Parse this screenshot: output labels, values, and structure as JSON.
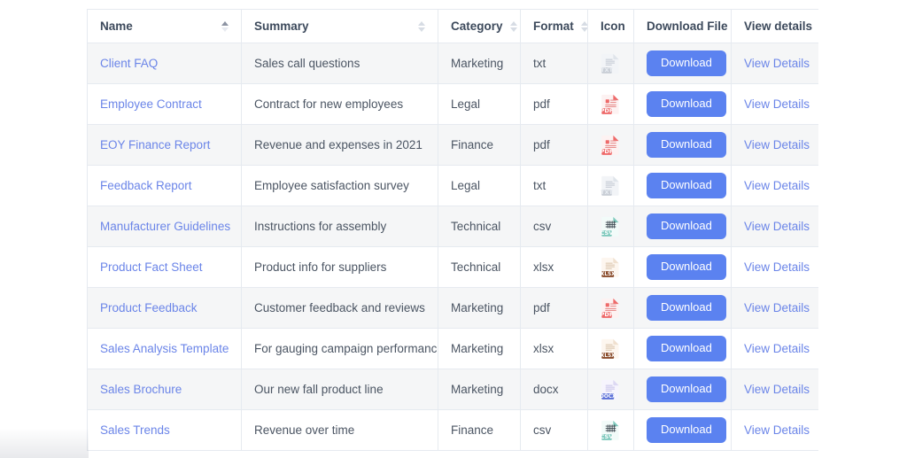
{
  "table": {
    "columns": [
      {
        "key": "name",
        "label": "Name",
        "sort": "asc",
        "sortable": true
      },
      {
        "key": "summary",
        "label": "Summary",
        "sort": "none",
        "sortable": true
      },
      {
        "key": "category",
        "label": "Category",
        "sort": "none",
        "sortable": true
      },
      {
        "key": "format",
        "label": "Format",
        "sort": "none",
        "sortable": true
      },
      {
        "key": "icon",
        "label": "Icon",
        "sort": null,
        "sortable": false
      },
      {
        "key": "download",
        "label": "Download File",
        "sort": null,
        "sortable": false
      },
      {
        "key": "view",
        "label": "View details",
        "sort": null,
        "sortable": false
      }
    ],
    "download_label": "Download",
    "view_label": "View Details",
    "rows": [
      {
        "name": "Client FAQ",
        "summary": "Sales call questions",
        "category": "Marketing",
        "format": "txt",
        "icon": "txt-file-icon",
        "download": "Download",
        "view": "View Details"
      },
      {
        "name": "Employee Contract",
        "summary": "Contract for new employees",
        "category": "Legal",
        "format": "pdf",
        "icon": "pdf-file-icon",
        "download": "Download",
        "view": "View Details"
      },
      {
        "name": "EOY Finance Report",
        "summary": "Revenue and expenses in 2021",
        "category": "Finance",
        "format": "pdf",
        "icon": "pdf-file-icon",
        "download": "Download",
        "view": "View Details"
      },
      {
        "name": "Feedback Report",
        "summary": "Employee satisfaction survey",
        "category": "Legal",
        "format": "txt",
        "icon": "txt-file-icon",
        "download": "Download",
        "view": "View Details"
      },
      {
        "name": "Manufacturer Guidelines",
        "summary": "Instructions for assembly",
        "category": "Technical",
        "format": "csv",
        "icon": "csv-file-icon",
        "download": "Download",
        "view": "View Details"
      },
      {
        "name": "Product Fact Sheet",
        "summary": "Product info for suppliers",
        "category": "Technical",
        "format": "xlsx",
        "icon": "xlsx-file-icon",
        "download": "Download",
        "view": "View Details"
      },
      {
        "name": "Product Feedback",
        "summary": "Customer feedback and reviews",
        "category": "Marketing",
        "format": "pdf",
        "icon": "pdf-file-icon",
        "download": "Download",
        "view": "View Details"
      },
      {
        "name": "Sales Analysis Template",
        "summary": "For gauging campaign performance",
        "category": "Marketing",
        "format": "xlsx",
        "icon": "xlsx-file-icon",
        "download": "Download",
        "view": "View Details"
      },
      {
        "name": "Sales Brochure",
        "summary": "Our new fall product line",
        "category": "Marketing",
        "format": "docx",
        "icon": "docx-file-icon",
        "download": "Download",
        "view": "View Details"
      },
      {
        "name": "Sales Trends",
        "summary": "Revenue over time",
        "category": "Finance",
        "format": "csv",
        "icon": "csv-file-icon",
        "download": "Download",
        "view": "View Details"
      }
    ]
  },
  "colors": {
    "link": "#6b85e8",
    "button": "#5b82f0",
    "header_text": "#3d4a5c",
    "body_text": "#4b5563",
    "border": "#e6eaf0",
    "row_odd": "#f5f6f7",
    "row_even": "#ffffff",
    "pdf": "#ee6a6a",
    "txt": "#c9ced6",
    "csv": "#7fc9bd",
    "xlsx": "#8a4b2a",
    "docx": "#5b6fd8"
  }
}
